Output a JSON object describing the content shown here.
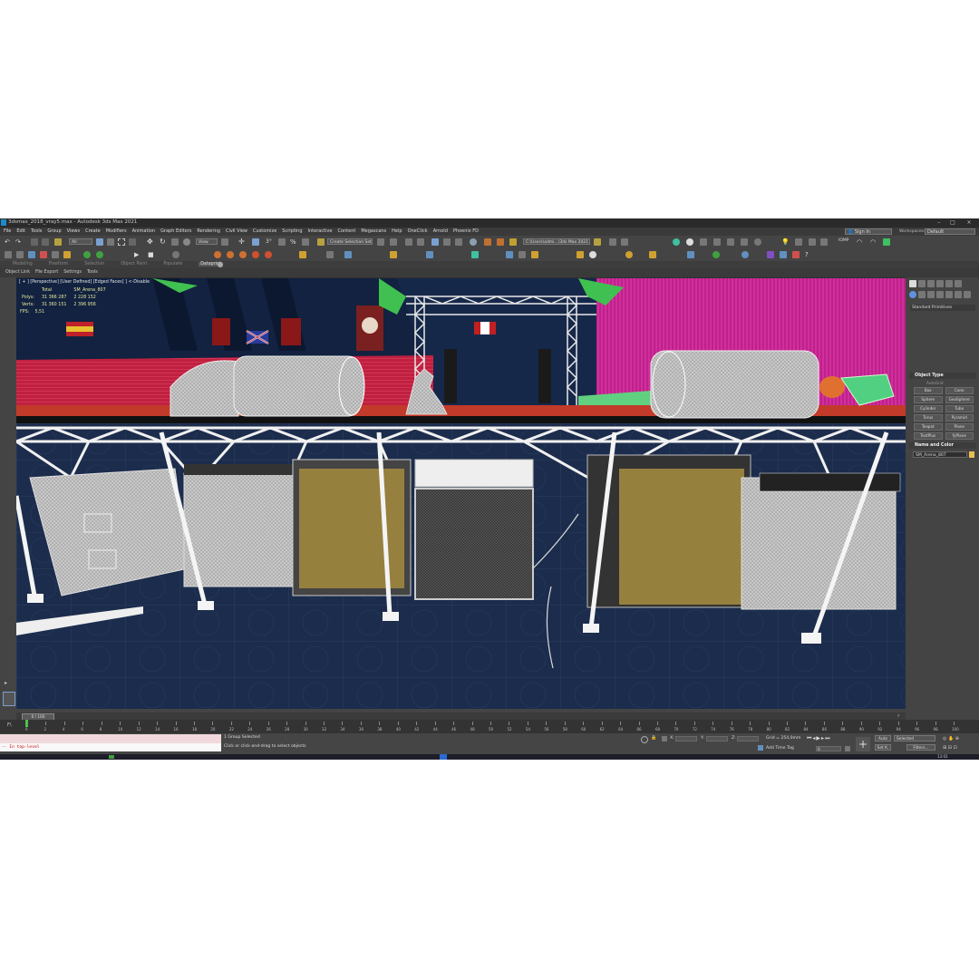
{
  "window": {
    "title": "3dsmax_2018_vray5.max - Autodesk 3ds Max 2021"
  },
  "menu": {
    "items": [
      "File",
      "Edit",
      "Tools",
      "Group",
      "Views",
      "Create",
      "Modifiers",
      "Animation",
      "Graph Editors",
      "Rendering",
      "Civil View",
      "Customize",
      "Scripting",
      "Interactive",
      "Content",
      "Megascans",
      "Help",
      "OneClick",
      "Arnold",
      "Phoenix FD"
    ],
    "sign_in": "Sign In",
    "workspaces_label": "Workspaces:",
    "workspace_value": "Default"
  },
  "toolbar": {
    "filter_value": "All",
    "view_value": "View",
    "selection_set": "Create Selection Set",
    "project_path": "C:\\Users\\admi...\\3ds Max 2021"
  },
  "ribbon": {
    "tabs": [
      "Modeling",
      "Freeform",
      "Selection",
      "Object Paint",
      "Populate",
      "Dataprint"
    ],
    "subitems": [
      "Object Link",
      "File Export",
      "Settings",
      "Tools"
    ]
  },
  "viewport": {
    "label": "[ + ] [Perspective] [User Defined] [Edged Faces] ] <-Disable",
    "stats_header": [
      "Total",
      "SM_Arena_807"
    ],
    "stats": [
      {
        "label": "Polys:",
        "total": "31 366 287",
        "sel": "2 228 152"
      },
      {
        "label": "Verts:",
        "total": "31 360 151",
        "sel": "2 396 956"
      }
    ],
    "fps_label": "FPS:",
    "fps_value": "5,51"
  },
  "command_panel": {
    "category": "Standard Primitives",
    "object_type_title": "Object Type",
    "autogrid_label": "AutoGrid",
    "object_types": [
      "Box",
      "Cone",
      "Sphere",
      "GeoSphere",
      "Cylinder",
      "Tube",
      "Torus",
      "Pyramid",
      "Teapot",
      "Plane",
      "TextPlus",
      "fyPlane"
    ],
    "name_color_title": "Name and Color",
    "object_name": "SM_Arena_807",
    "object_color": "#e8c050"
  },
  "timeline": {
    "frame_display": "0 / 100",
    "ticks": [
      "0",
      "2",
      "4",
      "6",
      "8",
      "10",
      "12",
      "14",
      "16",
      "18",
      "20",
      "22",
      "24",
      "26",
      "28",
      "30",
      "32",
      "34",
      "36",
      "38",
      "40",
      "42",
      "44",
      "46",
      "48",
      "50",
      "52",
      "54",
      "56",
      "58",
      "60",
      "62",
      "64",
      "66",
      "68",
      "70",
      "72",
      "74",
      "76",
      "78",
      "80",
      "82",
      "84",
      "86",
      "88",
      "90",
      "92",
      "94",
      "96",
      "98",
      "100"
    ]
  },
  "status": {
    "script_output": "-- In top-level",
    "selection_status": "1 Group Selected",
    "prompt": "Click or click-and-drag to select objects",
    "x_label": "X:",
    "y_label": "Y:",
    "z_label": "Z:",
    "grid": "Grid = 254,0mm",
    "add_time_tag": "Add Time Tag",
    "auto_key": "Auto",
    "selected": "Selected",
    "set_key": "Set K.",
    "filters": "Filters...",
    "frame_value": "0",
    "clock": "13:02"
  }
}
